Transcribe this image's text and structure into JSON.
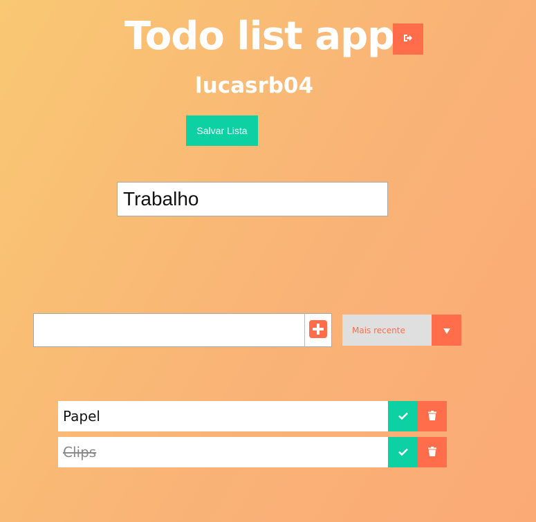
{
  "header": {
    "title": "Todo list app",
    "username": "lucasrb04",
    "logout_icon": "sign-out-icon"
  },
  "actions": {
    "save_label": "Salvar Lista"
  },
  "list": {
    "name_value": "Trabalho"
  },
  "new_todo": {
    "value": "",
    "placeholder": "",
    "add_icon": "plus-square-icon"
  },
  "filter": {
    "selected": "Mais recente",
    "arrow_icon": "caret-down-icon"
  },
  "todos": [
    {
      "text": "Papel",
      "completed": false
    },
    {
      "text": "Clips",
      "completed": true
    }
  ],
  "colors": {
    "accent": "#ff6d4a",
    "success": "#0dd1a2",
    "bg_start": "#f9c873",
    "bg_end": "#fbaa76"
  }
}
